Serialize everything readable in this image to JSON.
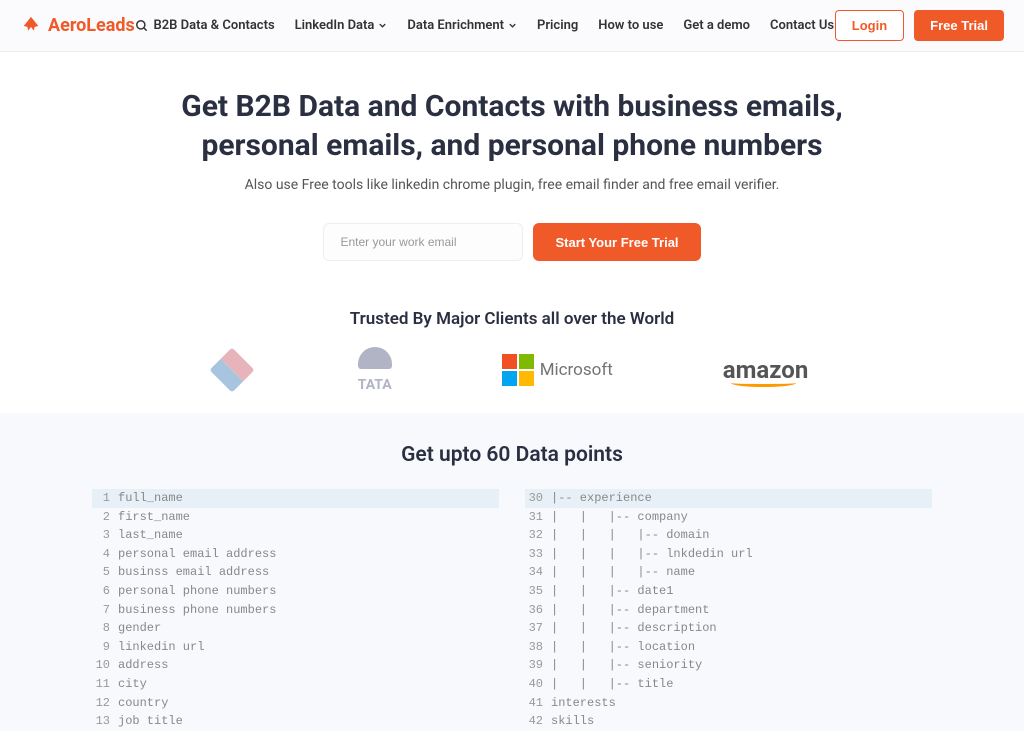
{
  "header": {
    "logo": "AeroLeads",
    "nav": [
      {
        "label": "B2B Data & Contacts",
        "hasIcon": "search",
        "hasChevron": false
      },
      {
        "label": "LinkedIn Data",
        "hasChevron": true
      },
      {
        "label": "Data Enrichment",
        "hasChevron": true
      },
      {
        "label": "Pricing",
        "hasChevron": false
      },
      {
        "label": "How to use",
        "hasChevron": false
      },
      {
        "label": "Get a demo",
        "hasChevron": false
      },
      {
        "label": "Contact Us",
        "hasChevron": false
      }
    ],
    "login": "Login",
    "freeTrial": "Free Trial"
  },
  "hero": {
    "headline": "Get B2B Data and Contacts with business emails, personal emails, and personal phone numbers",
    "sub": "Also use Free tools like linkedin chrome plugin, free email finder and free email verifier.",
    "emailPlaceholder": "Enter your work email",
    "cta": "Start Your Free Trial"
  },
  "trusted": {
    "title": "Trusted By Major Clients all over the World",
    "clients": [
      "Dominos",
      "TATA",
      "Microsoft",
      "amazon"
    ]
  },
  "dataPoints": {
    "title": "Get upto 60 Data points",
    "col1": [
      {
        "n": "1",
        "t": "full_name",
        "hl": true
      },
      {
        "n": "2",
        "t": "first_name"
      },
      {
        "n": "3",
        "t": "last_name"
      },
      {
        "n": "4",
        "t": "personal email address"
      },
      {
        "n": "5",
        "t": "businss email address"
      },
      {
        "n": "6",
        "t": "personal phone numbers"
      },
      {
        "n": "7",
        "t": "business phone numbers"
      },
      {
        "n": "8",
        "t": "gender"
      },
      {
        "n": "9",
        "t": "linkedin url"
      },
      {
        "n": "10",
        "t": "address"
      },
      {
        "n": "11",
        "t": "city"
      },
      {
        "n": "12",
        "t": "country"
      },
      {
        "n": "13",
        "t": "job title"
      }
    ],
    "col2": [
      {
        "n": "30",
        "t": "|-- experience",
        "hl": true
      },
      {
        "n": "31",
        "t": "|   |   |-- company"
      },
      {
        "n": "32",
        "t": "|   |   |   |-- domain"
      },
      {
        "n": "33",
        "t": "|   |   |   |-- lnkdedin url"
      },
      {
        "n": "34",
        "t": "|   |   |   |-- name"
      },
      {
        "n": "35",
        "t": "|   |   |-- date1"
      },
      {
        "n": "36",
        "t": "|   |   |-- department"
      },
      {
        "n": "37",
        "t": "|   |   |-- description"
      },
      {
        "n": "38",
        "t": "|   |   |-- location"
      },
      {
        "n": "39",
        "t": "|   |   |-- seniority"
      },
      {
        "n": "40",
        "t": "|   |   |-- title"
      },
      {
        "n": "41",
        "t": "interests"
      },
      {
        "n": "42",
        "t": "skills"
      }
    ]
  }
}
